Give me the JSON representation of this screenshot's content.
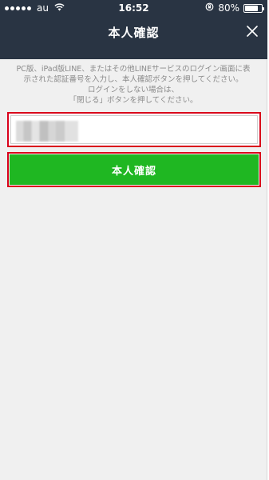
{
  "status_bar": {
    "carrier": "au",
    "time": "16:52",
    "battery": "80%",
    "battery_level": 0.8,
    "icons": [
      "signal-dots-icon",
      "wifi-icon",
      "rotation-lock-icon",
      "battery-icon"
    ]
  },
  "header": {
    "title": "本人確認",
    "close_icon": "close-icon"
  },
  "instructions": {
    "line1": "PC版、iPad版LINE、またはその他LINEサービスのログイン画面に表",
    "line2": "示された認証番号を入力し、本人確認ボタンを押してください。",
    "line3": "ログインをしない場合は、",
    "line4": "「閉じる」ボタンを押してください。"
  },
  "code_input": {
    "value": "",
    "placeholder": ""
  },
  "confirm_button": {
    "label": "本人確認"
  },
  "colors": {
    "header_bg": "#293443",
    "button_green": "#1fb722",
    "highlight_red": "#d9001b",
    "background": "#f0f0f0"
  }
}
